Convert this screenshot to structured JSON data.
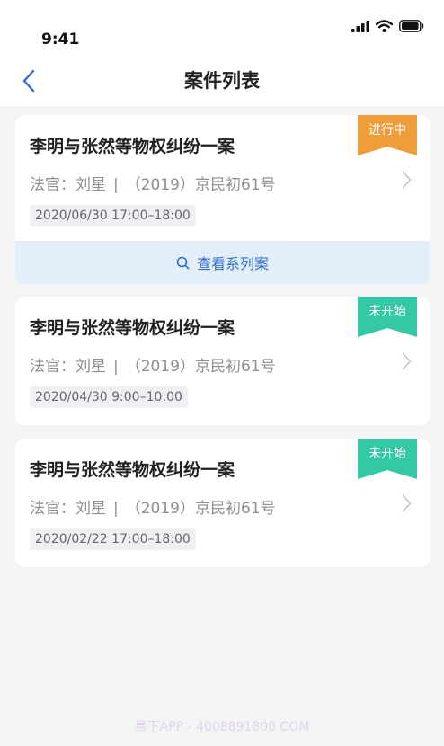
{
  "status_bar": {
    "time": "9:41"
  },
  "nav": {
    "title": "案件列表"
  },
  "cases": [
    {
      "title": "李明与张然等物权纠纷一案",
      "judge_label": "法官：刘星",
      "separator": "|",
      "case_no": "（2019）京民初61号",
      "datetime": "2020/06/30  17:00–18:00",
      "status": "进行中",
      "status_color": "#ef9d3a",
      "action_label": "查看系列案"
    },
    {
      "title": "李明与张然等物权纠纷一案",
      "judge_label": "法官：刘星",
      "separator": "|",
      "case_no": "（2019）京民初61号",
      "datetime": "2020/04/30  9:00–10:00",
      "status": "未开始",
      "status_color": "#33c9a6"
    },
    {
      "title": "李明与张然等物权纠纷一案",
      "judge_label": "法官：刘星",
      "separator": "|",
      "case_no": "（2019）京民初61号",
      "datetime": "2020/02/22 17:00–18:00",
      "status": "未开始",
      "status_color": "#33c9a6"
    }
  ],
  "watermark": "易下APP - 4008891800 COM"
}
